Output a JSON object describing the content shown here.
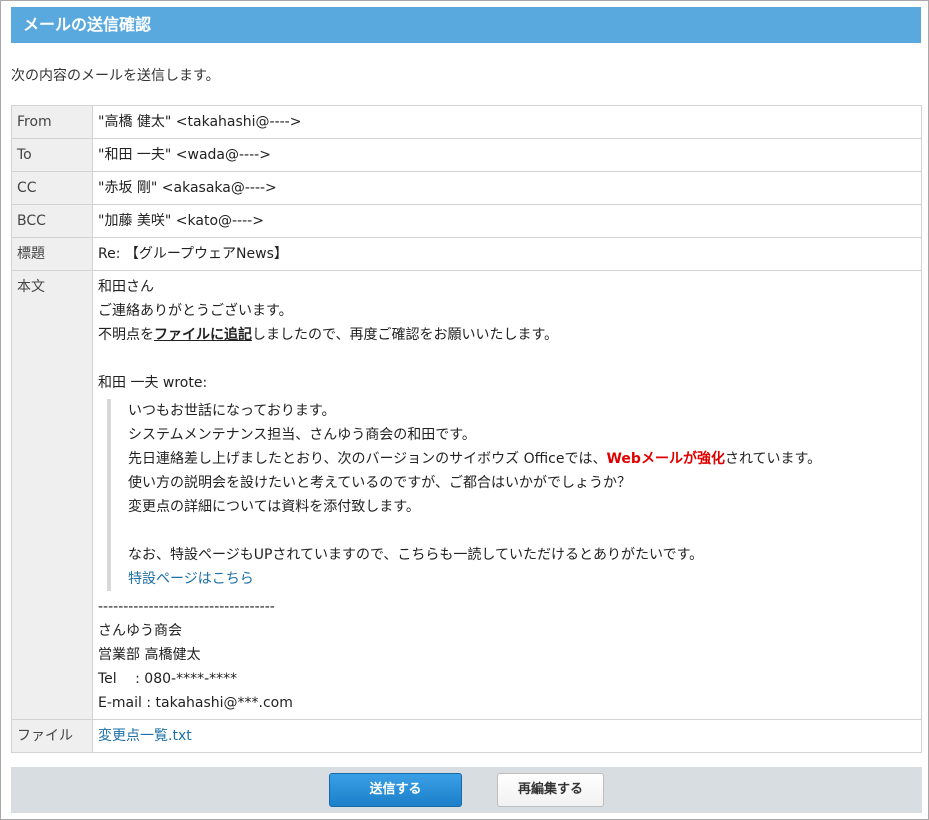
{
  "header": {
    "title": "メールの送信確認"
  },
  "intro": "次の内容のメールを送信します。",
  "fields": [
    {
      "label": "From",
      "value": "\"高橋 健太\" <takahashi@---->"
    },
    {
      "label": "To",
      "value": "\"和田 一夫\" <wada@---->"
    },
    {
      "label": "CC",
      "value": "\"赤坂 剛\" <akasaka@---->"
    },
    {
      "label": "BCC",
      "value": "\"加藤 美咲\" <kato@---->"
    },
    {
      "label": "標題",
      "value": "Re: 【グループウェアNews】"
    }
  ],
  "body": {
    "label": "本文",
    "greeting": "和田さん",
    "line1": "ご連絡ありがとうございます。",
    "line2_prefix": "不明点を",
    "line2_emphasis": "ファイルに追記",
    "line2_suffix": "しましたので、再度ご確認をお願いいたします。",
    "wrote": "和田 一夫 wrote:",
    "quote": {
      "line1": "いつもお世話になっております。",
      "line2": "システムメンテナンス担当、さんゆう商会の和田です。",
      "line3_prefix": "先日連絡差し上げましたとおり、次のバージョンのサイボウズ Officeでは、",
      "line3_highlight": "Webメールが強化",
      "line3_suffix": "されています。",
      "line4": "使い方の説明会を設けたいと考えているのですが、ご都合はいかがでしょうか？",
      "line5": "変更点の詳細については資料を添付致します。",
      "line6": "なお、特設ページもUPされていますので、こちらも一読していただけるとありがたいです。",
      "link": "特設ページはこちら"
    },
    "signature": {
      "divider": "-----------------------------------",
      "company": "さんゆう商会",
      "name": "営業部 高橋健太",
      "tel": "Tel　 : 080-****-****",
      "email": "E-mail : takahashi@***.com"
    }
  },
  "file": {
    "label": "ファイル",
    "name": "変更点一覧.txt"
  },
  "buttons": {
    "send": "送信する",
    "reedit": "再編集する"
  },
  "colors": {
    "title_bar": "#5aa9de",
    "link": "#1c6fa8",
    "highlight": "#e00000",
    "send_button": "#1b7fc9"
  }
}
